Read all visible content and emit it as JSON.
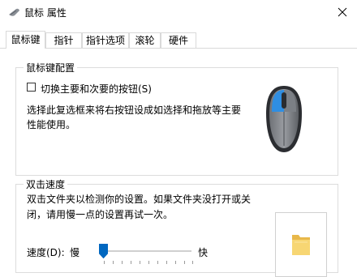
{
  "window": {
    "title": "鼠标 属性",
    "icon": "mouse-app-icon",
    "close_icon": "close-icon"
  },
  "tabs": [
    {
      "label": "鼠标键",
      "active": true
    },
    {
      "label": "指针",
      "active": false
    },
    {
      "label": "指针选项",
      "active": false
    },
    {
      "label": "滚轮",
      "active": false
    },
    {
      "label": "硬件",
      "active": false
    }
  ],
  "button_config": {
    "legend": "鼠标键配置",
    "switch_checkbox": {
      "label": "切换主要和次要的按钮(S)",
      "checked": false
    },
    "description_lines": [
      "选择此复选框来将右按钮设成如选择和拖放等主要",
      "性能使用。"
    ],
    "mouse_image": "mouse-icon"
  },
  "double_click": {
    "legend": "双击速度",
    "description_lines": [
      "双击文件夹以检测你的设置。如果文件夹没打开或关",
      "闭，请用慢一点的设置再试一次。"
    ],
    "test_folder_icon": "folder-icon",
    "speed_label": "速度(D):",
    "slow_label": "慢",
    "fast_label": "快",
    "speed_fraction": 0.0
  },
  "colors": {
    "accent": "#0067c0",
    "mouse_blue": "#2e8de0",
    "folder_yellow": "#f6d36b"
  }
}
